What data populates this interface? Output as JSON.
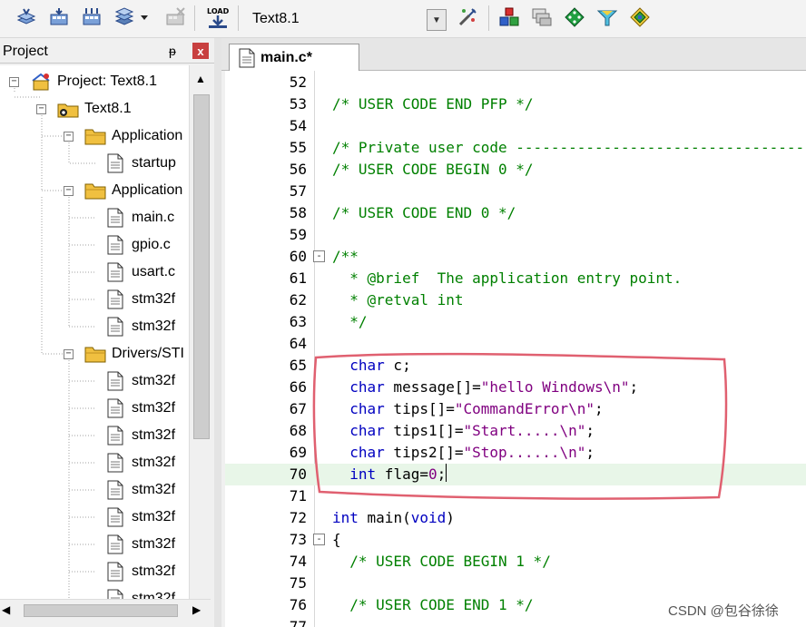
{
  "toolbar": {
    "target_name": "Text8.1",
    "icons": [
      "translate-icon",
      "build-icon",
      "rebuild-icon",
      "batch-build-icon",
      "stop-build-icon",
      "download-icon",
      "target-options-icon",
      "manage-components-icon",
      "manage-environment-icon",
      "run-time-env-icon",
      "pack-installer-icon",
      "event-recorder-icon"
    ],
    "download_label": "LOAD"
  },
  "project_panel": {
    "title": "Project",
    "pin_glyph": "ᵽ",
    "close_glyph": "x",
    "tree": [
      {
        "level": 0,
        "label": "Project: Text8.1",
        "icon": "project-icon",
        "expander": "⊟"
      },
      {
        "level": 1,
        "label": "Text8.1",
        "icon": "target-icon",
        "expander": "⊟"
      },
      {
        "level": 2,
        "label": "Application",
        "icon": "folder-icon",
        "expander": "⊟"
      },
      {
        "level": 3,
        "label": "startup",
        "icon": "file-icon"
      },
      {
        "level": 2,
        "label": "Application",
        "icon": "folder-icon",
        "expander": "⊟"
      },
      {
        "level": 3,
        "label": "main.c",
        "icon": "file-icon",
        "selected": true
      },
      {
        "level": 3,
        "label": "gpio.c",
        "icon": "file-icon"
      },
      {
        "level": 3,
        "label": "usart.c",
        "icon": "file-icon"
      },
      {
        "level": 3,
        "label": "stm32f",
        "icon": "file-icon"
      },
      {
        "level": 3,
        "label": "stm32f",
        "icon": "file-icon"
      },
      {
        "level": 2,
        "label": "Drivers/STI",
        "icon": "folder-icon",
        "expander": "⊟"
      },
      {
        "level": 3,
        "label": "stm32f",
        "icon": "file-icon"
      },
      {
        "level": 3,
        "label": "stm32f",
        "icon": "file-icon"
      },
      {
        "level": 3,
        "label": "stm32f",
        "icon": "file-icon"
      },
      {
        "level": 3,
        "label": "stm32f",
        "icon": "file-icon"
      },
      {
        "level": 3,
        "label": "stm32f",
        "icon": "file-icon"
      },
      {
        "level": 3,
        "label": "stm32f",
        "icon": "file-icon"
      },
      {
        "level": 3,
        "label": "stm32f",
        "icon": "file-icon"
      },
      {
        "level": 3,
        "label": "stm32f",
        "icon": "file-icon"
      },
      {
        "level": 3,
        "label": "stm32f",
        "icon": "file-icon"
      }
    ]
  },
  "editor": {
    "tab_label": "main.c*",
    "lines": [
      {
        "n": "52",
        "code": ""
      },
      {
        "n": "53",
        "code": "/* USER CODE END PFP */"
      },
      {
        "n": "54",
        "code": ""
      },
      {
        "n": "55",
        "code": "/* Private user code ---------------------------------------------------------"
      },
      {
        "n": "56",
        "code": "/* USER CODE BEGIN 0 */"
      },
      {
        "n": "57",
        "code": ""
      },
      {
        "n": "58",
        "code": "/* USER CODE END 0 */"
      },
      {
        "n": "59",
        "code": ""
      },
      {
        "n": "60",
        "code": "/**",
        "fold": "-"
      },
      {
        "n": "61",
        "code": "  * @brief  The application entry point."
      },
      {
        "n": "62",
        "code": "  * @retval int"
      },
      {
        "n": "63",
        "code": "  */"
      },
      {
        "n": "64",
        "code": ""
      },
      {
        "n": "65",
        "code": "  char c;"
      },
      {
        "n": "66",
        "code": "  char message[]=\"hello Windows\\n\";"
      },
      {
        "n": "67",
        "code": "  char tips[]=\"CommandError\\n\";"
      },
      {
        "n": "68",
        "code": "  char tips1[]=\"Start.....\\n\";"
      },
      {
        "n": "69",
        "code": "  char tips2[]=\"Stop......\\n\";"
      },
      {
        "n": "70",
        "code": "  int flag=0;",
        "current": true
      },
      {
        "n": "71",
        "code": ""
      },
      {
        "n": "72",
        "code": "int main(void)"
      },
      {
        "n": "73",
        "code": "{",
        "fold": "-"
      },
      {
        "n": "74",
        "code": "  /* USER CODE BEGIN 1 */"
      },
      {
        "n": "75",
        "code": ""
      },
      {
        "n": "76",
        "code": "  /* USER CODE END 1 */"
      },
      {
        "n": "77",
        "code": ""
      }
    ]
  },
  "watermark": "CSDN @包谷徐徐",
  "colors": {
    "comment": "#008000",
    "keyword": "#0000c0",
    "string": "#800080",
    "annotation": "#e06070",
    "current_line": "#e8f6e8"
  }
}
